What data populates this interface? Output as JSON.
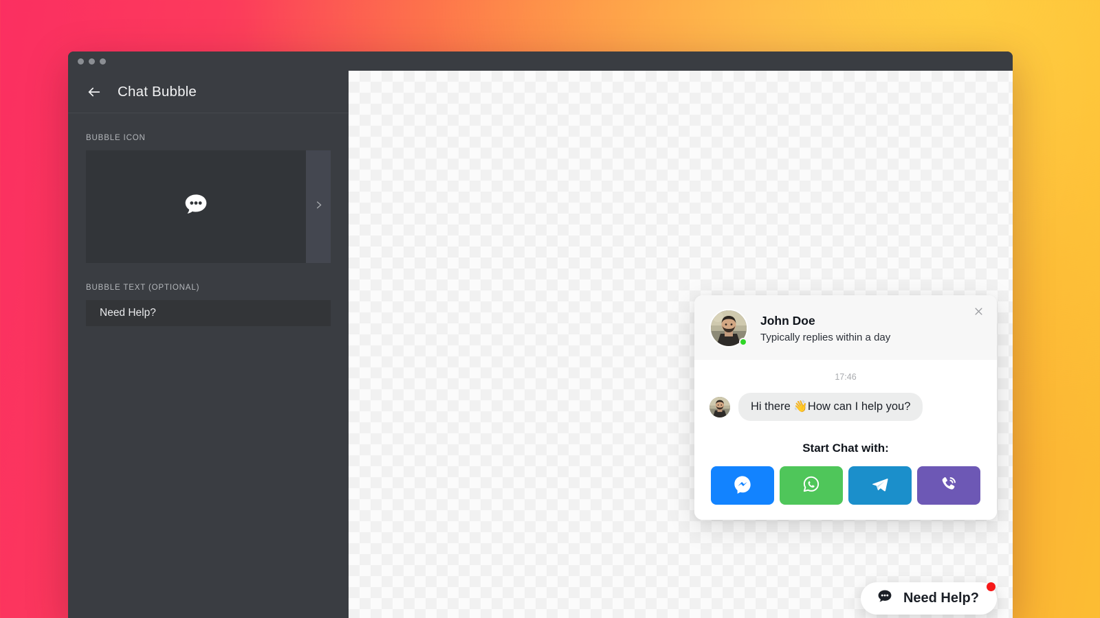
{
  "window": {
    "traffic_dots": 3
  },
  "sidebar": {
    "title": "Chat Bubble",
    "back_icon": "arrow-left-icon",
    "fields": [
      {
        "label": "BUBBLE ICON",
        "icon": "chat-bubble-dots-icon",
        "next_icon": "chevron-right-icon"
      },
      {
        "label": "BUBBLE TEXT (OPTIONAL)",
        "value": "Need Help?",
        "placeholder": "Need Help?"
      }
    ]
  },
  "chat_widget": {
    "close_icon": "close-icon",
    "agent": {
      "name": "John Doe",
      "status_text": "Typically replies within a day",
      "avatar": "agent-photo",
      "online": true,
      "online_color": "#2fd626"
    },
    "conversation": {
      "time": "17:46",
      "messages": [
        {
          "text": "Hi there 👋How can I help you?",
          "avatar": "agent-photo-small"
        }
      ]
    },
    "start_chat_title": "Start Chat with:",
    "channels": [
      {
        "name": "Messenger",
        "icon": "messenger-icon",
        "color": "#1283ff"
      },
      {
        "name": "WhatsApp",
        "icon": "whatsapp-icon",
        "color": "#4fc65a"
      },
      {
        "name": "Telegram",
        "icon": "telegram-icon",
        "color": "#1b8fcb"
      },
      {
        "name": "Viber",
        "icon": "viber-icon",
        "color": "#6d58b5"
      }
    ]
  },
  "floating_button": {
    "label": "Need Help?",
    "icon": "chat-bubble-dots-icon",
    "badge_color": "#f61818"
  }
}
